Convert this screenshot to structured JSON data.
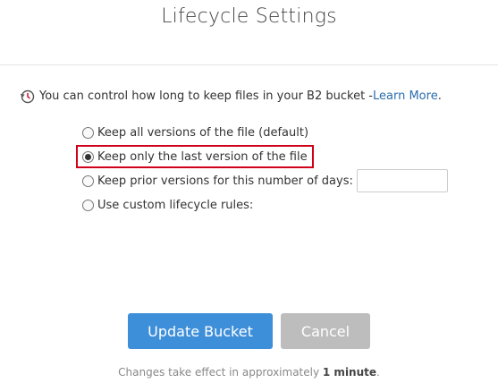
{
  "dialog": {
    "title": "Lifecycle Settings"
  },
  "info": {
    "icon": "clock-history-icon",
    "text": "You can control how long to keep files in your B2 bucket - ",
    "link_label": "Learn More",
    "suffix": "."
  },
  "options": [
    {
      "label": "Keep all versions of the file (default)",
      "checked": false
    },
    {
      "label": "Keep only the last version of the file",
      "checked": true
    },
    {
      "label": "Keep prior versions for this number of days:",
      "checked": false
    },
    {
      "label": "Use custom lifecycle rules:",
      "checked": false
    }
  ],
  "days_input": {
    "value": ""
  },
  "buttons": {
    "update_label": "Update Bucket",
    "cancel_label": "Cancel"
  },
  "footnote": {
    "prefix": "Changes take effect in approximately ",
    "emphasis": "1 minute",
    "suffix": "."
  },
  "colors": {
    "primary": "#3e8fda",
    "secondary": "#bdbdbd",
    "link": "#2a6db0",
    "highlight": "#d0021b"
  }
}
